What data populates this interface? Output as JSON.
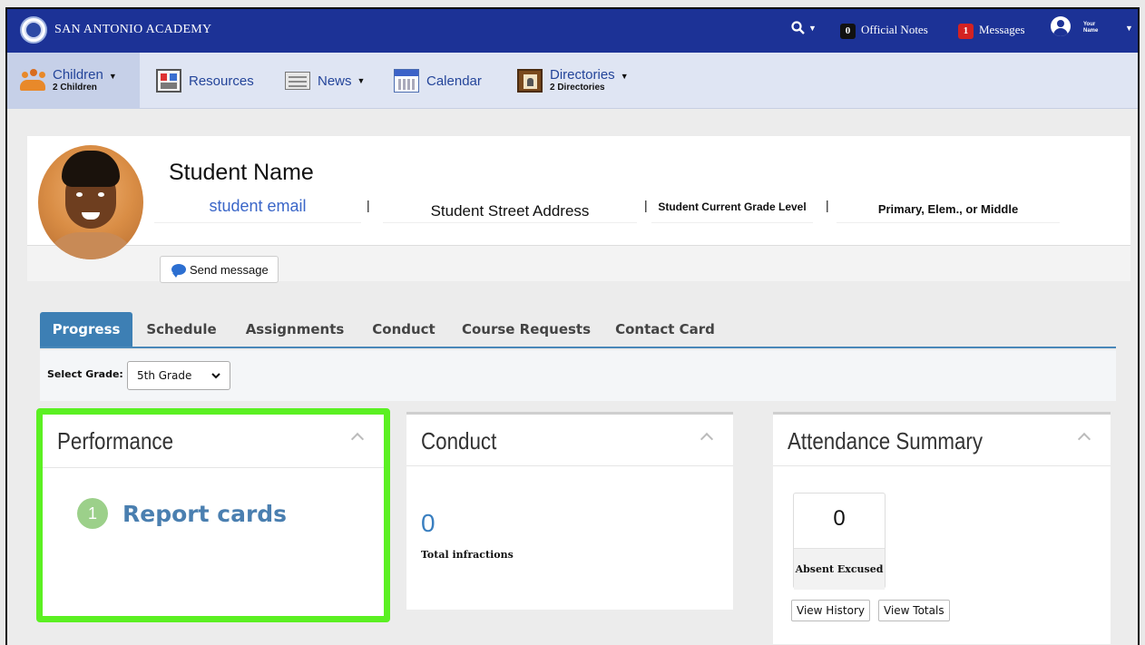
{
  "topbar": {
    "school_name": "SAN ANTONIO ACADEMY",
    "official_notes_count": "0",
    "official_notes_label": "Official Notes",
    "messages_count": "1",
    "messages_label": "Messages",
    "user_name": "Your Name",
    "brand_color": "#1c3296"
  },
  "nav": {
    "children_label": "Children",
    "children_sub": "2 Children",
    "resources_label": "Resources",
    "news_label": "News",
    "calendar_label": "Calendar",
    "directories_label": "Directories",
    "directories_sub": "2 Directories"
  },
  "profile": {
    "name": "Student Name",
    "email": "student email",
    "address": "Student Street Address",
    "grade_level": "Student Current Grade Level",
    "school_level": "Primary, Elem., or Middle",
    "send_message_label": "Send message",
    "separator": "|"
  },
  "tabs": [
    {
      "label": "Progress",
      "active": true
    },
    {
      "label": "Schedule",
      "active": false
    },
    {
      "label": "Assignments",
      "active": false
    },
    {
      "label": "Conduct",
      "active": false
    },
    {
      "label": "Course Requests",
      "active": false
    },
    {
      "label": "Contact Card",
      "active": false
    }
  ],
  "grade_select": {
    "label": "Select Grade:",
    "value": "5th Grade"
  },
  "performance": {
    "title": "Performance",
    "report_cards_count": "1",
    "report_cards_label": "Report cards",
    "highlight_color": "#5bf022"
  },
  "conduct": {
    "title": "Conduct",
    "total_infractions": "0",
    "total_infractions_label": "Total infractions"
  },
  "attendance": {
    "title": "Attendance Summary",
    "absent_excused_count": "0",
    "absent_excused_label": "Absent Excused",
    "view_history_label": "View History",
    "view_totals_label": "View Totals"
  },
  "icons": [
    "search-icon",
    "user-avatar-icon",
    "people-icon",
    "resources-icon",
    "news-icon",
    "calendar-icon",
    "directories-icon",
    "chat-bubble-icon",
    "collapse-chevron-icon"
  ]
}
